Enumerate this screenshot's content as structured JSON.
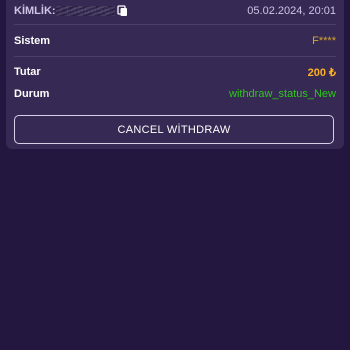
{
  "transaction": {
    "id_label": "KİMLİK:",
    "id_value": "71466656",
    "date": "05.02.2024, 20:01",
    "system_label": "Sistem",
    "system_value": "F****",
    "amount_label": "Tutar",
    "amount_value": "200 ₺",
    "status_label": "Durum",
    "status_value": "withdraw_status_New"
  },
  "actions": {
    "cancel_label": "CANCEL WİTHDRAW"
  },
  "colors": {
    "background": "#23163f",
    "card": "#362953",
    "amount": "#ffb020",
    "system": "#d6a830",
    "status": "#2ec71a"
  },
  "icons": {
    "copy": "copy-icon"
  }
}
